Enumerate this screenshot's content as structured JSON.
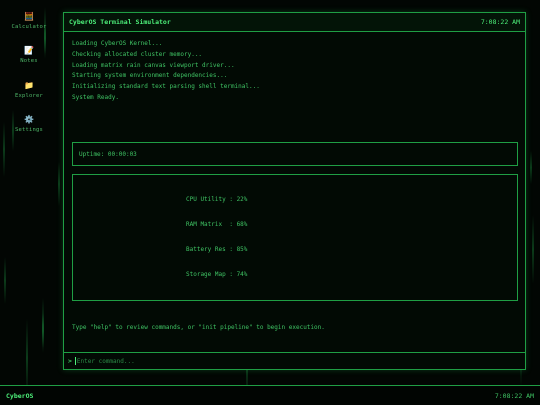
{
  "desktop": {
    "icons": [
      {
        "label": "Calculator",
        "glyph": "🧮"
      },
      {
        "label": "Notes",
        "glyph": "📝"
      },
      {
        "label": "Explorer",
        "glyph": "📁"
      },
      {
        "label": "Settings",
        "glyph": "⚙️"
      }
    ]
  },
  "window": {
    "title": "CyberOS Terminal Simulator",
    "clock": "7:08:22 AM",
    "log": [
      "Loading CyberOS Kernel...",
      "Checking allocated cluster memory...",
      "Loading matrix rain canvas viewport driver...",
      "Starting system environment dependencies...",
      "Initializing standard text parsing shell terminal...",
      "System Ready."
    ],
    "uptime": "Uptime: 00:00:03",
    "stats": {
      "cpu": "CPU Utility : 22%",
      "ram": "RAM Matrix  : 68%",
      "battery": "Battery Res : 85%",
      "storage": "Storage Map : 74%"
    },
    "hint": "Type \"help\" to review commands, or \"init pipeline\" to begin execution.",
    "prompt": ">",
    "command_placeholder": "Enter command..."
  },
  "taskbar": {
    "brand": "CyberOS",
    "clock": "7:08:22 AM"
  },
  "colors": {
    "accent": "#4df07a",
    "border": "#1f9e44",
    "background": "#020603"
  }
}
